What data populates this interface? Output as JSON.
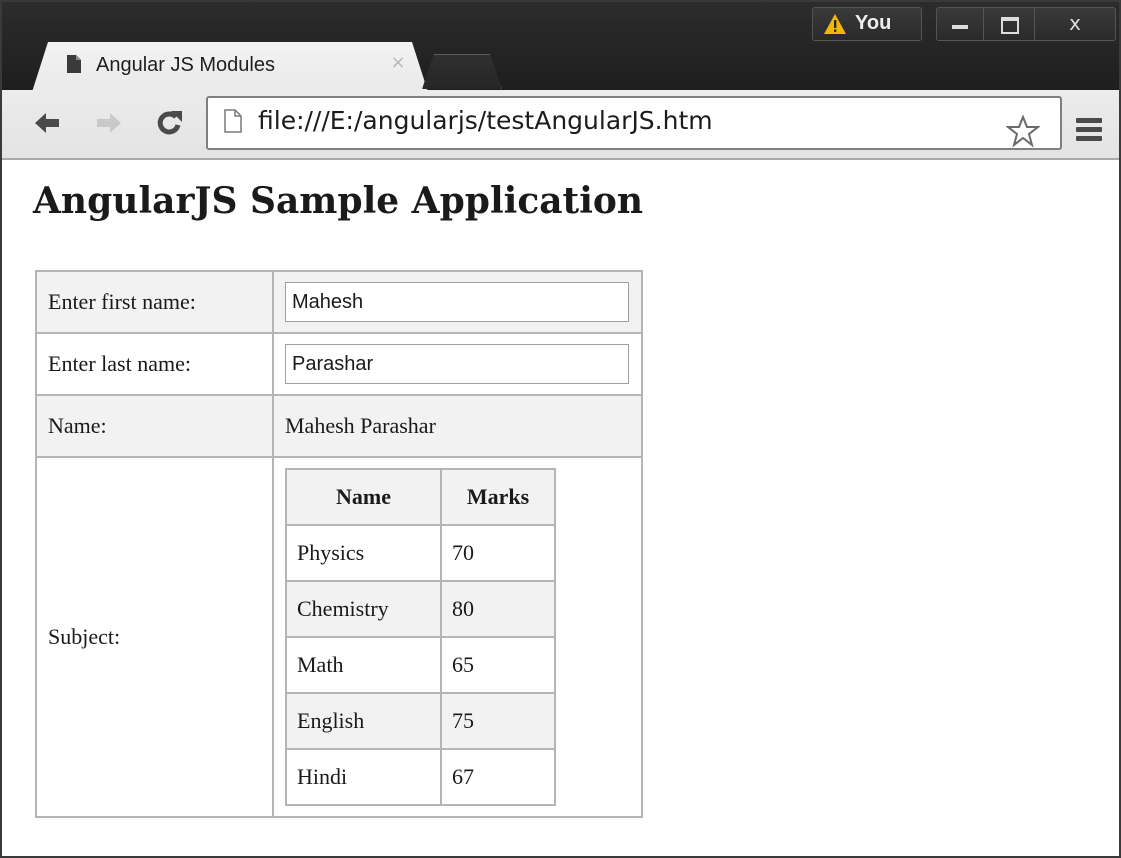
{
  "browser": {
    "tab_title": "Angular JS Modules",
    "tab_close_glyph": "×",
    "user_label": "You",
    "close_glyph": "x",
    "url": "file:///E:/angularjs/testAngularJS.htm",
    "icons": [
      "page-icon",
      "close-icon",
      "warning-icon",
      "minimize-icon",
      "maximize-icon",
      "back-icon",
      "forward-icon",
      "reload-icon",
      "star-icon",
      "menu-icon"
    ]
  },
  "page": {
    "heading": "AngularJS Sample Application",
    "first_name_label": "Enter first name:",
    "first_name_value": "Mahesh",
    "last_name_label": "Enter last name:",
    "last_name_value": "Parashar",
    "name_label": "Name:",
    "name_value": "Mahesh Parashar",
    "subject_label": "Subject:",
    "subjects": {
      "headers": [
        "Name",
        "Marks"
      ],
      "rows": [
        [
          "Physics",
          "70"
        ],
        [
          "Chemistry",
          "80"
        ],
        [
          "Math",
          "65"
        ],
        [
          "English",
          "75"
        ],
        [
          "Hindi",
          "67"
        ]
      ]
    }
  },
  "colors": {
    "titlebar": "#1e1e1e",
    "toolbar": "#e6e6e6",
    "table_border": "#b5b5b5",
    "row_shade": "#f2f2f2",
    "warning": "#f2b705"
  }
}
